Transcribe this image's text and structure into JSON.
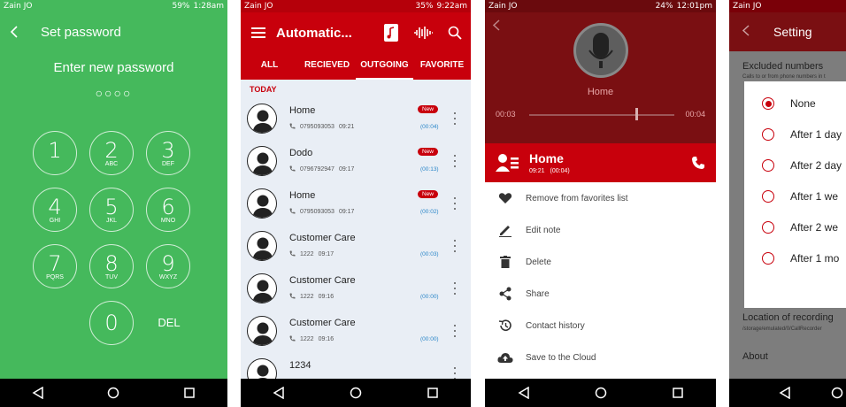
{
  "panel1": {
    "status": {
      "carrier": "Zain JO",
      "battery": "59%",
      "time": "1:28am"
    },
    "title": "Set password",
    "prompt": "Enter new password",
    "dots": "○○○○",
    "keys": [
      {
        "num": "1",
        "letters": ""
      },
      {
        "num": "2",
        "letters": "ABC"
      },
      {
        "num": "3",
        "letters": "DEF"
      },
      {
        "num": "4",
        "letters": "GHI"
      },
      {
        "num": "5",
        "letters": "JKL"
      },
      {
        "num": "6",
        "letters": "MNO"
      },
      {
        "num": "7",
        "letters": "PQRS"
      },
      {
        "num": "8",
        "letters": "TUV"
      },
      {
        "num": "9",
        "letters": "WXYZ"
      },
      {
        "num": "0",
        "letters": ""
      }
    ],
    "del_label": "DEL"
  },
  "panel2": {
    "status": {
      "carrier": "Zain JO",
      "battery": "35%",
      "time": "9:22am"
    },
    "title": "Automatic...",
    "tabs": [
      "ALL",
      "RECIEVED",
      "OUTGOING",
      "FAVORITE"
    ],
    "active_tab": "OUTGOING",
    "section": "TODAY",
    "calls": [
      {
        "name": "Home",
        "number": "0795093053",
        "time": "09:21",
        "duration": "(00:04)",
        "badge": "New"
      },
      {
        "name": "Dodo",
        "number": "0796792947",
        "time": "09:17",
        "duration": "(00:13)",
        "badge": "New"
      },
      {
        "name": "Home",
        "number": "0795093053",
        "time": "09:17",
        "duration": "(00:02)",
        "badge": "New"
      },
      {
        "name": "Customer Care",
        "number": "1222",
        "time": "09:17",
        "duration": "(00:03)",
        "badge": ""
      },
      {
        "name": "Customer Care",
        "number": "1222",
        "time": "09:16",
        "duration": "(00:00)",
        "badge": ""
      },
      {
        "name": "Customer Care",
        "number": "1222",
        "time": "09:16",
        "duration": "(00:00)",
        "badge": ""
      },
      {
        "name": "1234",
        "number": "",
        "time": "",
        "duration": "",
        "badge": ""
      }
    ]
  },
  "panel3": {
    "status": {
      "carrier": "Zain JO",
      "battery": "24%",
      "time": "12:01pm"
    },
    "player_name": "Home",
    "elapsed": "00:03",
    "total": "00:04",
    "progress": 0.73,
    "contact": {
      "name": "Home",
      "time": "09:21",
      "duration": "(00:04)"
    },
    "menu": [
      {
        "icon": "heart-icon",
        "label": "Remove from favorites list"
      },
      {
        "icon": "pencil-icon",
        "label": "Edit note"
      },
      {
        "icon": "trash-icon",
        "label": "Delete"
      },
      {
        "icon": "share-icon",
        "label": "Share"
      },
      {
        "icon": "history-icon",
        "label": "Contact history"
      },
      {
        "icon": "cloud-upload-icon",
        "label": "Save to the Cloud"
      }
    ]
  },
  "panel4": {
    "status": {
      "carrier": "Zain JO"
    },
    "title": "Setting",
    "excluded_title": "Excluded numbers",
    "excluded_sub": "Calls to or from phone numbers in t",
    "options": [
      "None",
      "After 1 day",
      "After 2 day",
      "After 1 we",
      "After 2 we",
      "After 1 mo"
    ],
    "selected_index": 0,
    "location_title": "Location of recording",
    "location_sub": "/storage/emulated/0/CallRecorder",
    "about": "About"
  },
  "colors": {
    "green": "#45b95c",
    "red": "#c8000c",
    "dark_red": "#7a0f12",
    "link_blue": "#2a86c8"
  }
}
